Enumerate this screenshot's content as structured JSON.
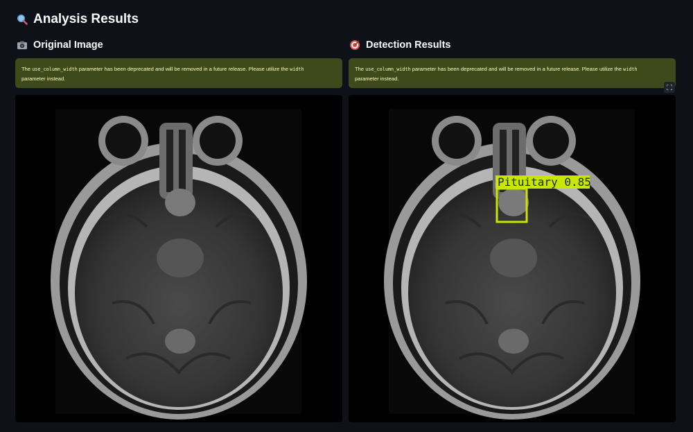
{
  "header": {
    "title": "Analysis Results",
    "title_icon": "magnifying-glass-icon"
  },
  "original": {
    "title": "Original Image",
    "title_icon": "camera-icon"
  },
  "detection": {
    "title": "Detection Results",
    "title_icon": "target-icon",
    "box_label": "Pituitary 0.85",
    "box_color": "#c8e600"
  },
  "warning": {
    "prefix": "The ",
    "code1": "use_column_width",
    "middle": " parameter has been deprecated and will be removed in a future release. Please utilize the ",
    "code2": "width",
    "suffix": "parameter instead."
  },
  "colors": {
    "background": "#0e1117",
    "warning_bg": "#3e4a1b",
    "warning_text": "#fdfdbd"
  }
}
